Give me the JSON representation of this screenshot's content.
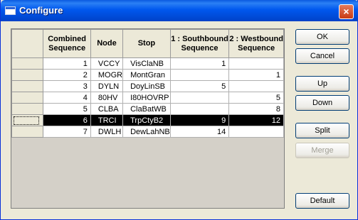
{
  "window": {
    "title": "Configure",
    "close_label": "×"
  },
  "grid": {
    "headers": [
      "Combined Sequence",
      "Node",
      "Stop",
      "1 : Southbound Sequence",
      "2 : Westbound Sequence"
    ],
    "rows": [
      {
        "seq": "1",
        "node": "VCCY",
        "stop": "VisClaNB",
        "south": "1",
        "west": ""
      },
      {
        "seq": "2",
        "node": "MOGR",
        "stop": "MontGran",
        "south": "",
        "west": "1"
      },
      {
        "seq": "3",
        "node": "DYLN",
        "stop": "DoyLinSB",
        "south": "5",
        "west": ""
      },
      {
        "seq": "4",
        "node": "80HV",
        "stop": "I80HOVRP",
        "south": "",
        "west": "5"
      },
      {
        "seq": "5",
        "node": "CLBA",
        "stop": "ClaBatWB",
        "south": "",
        "west": "8"
      },
      {
        "seq": "6",
        "node": "TRCI",
        "stop": "TrpCtyB2",
        "south": "9",
        "west": "12"
      },
      {
        "seq": "7",
        "node": "DWLH",
        "stop": "DewLahNB",
        "south": "14",
        "west": ""
      }
    ],
    "selected_row": 6
  },
  "buttons": {
    "ok": "OK",
    "cancel": "Cancel",
    "up": "Up",
    "down": "Down",
    "split": "Split",
    "merge": "Merge",
    "default": "Default"
  }
}
